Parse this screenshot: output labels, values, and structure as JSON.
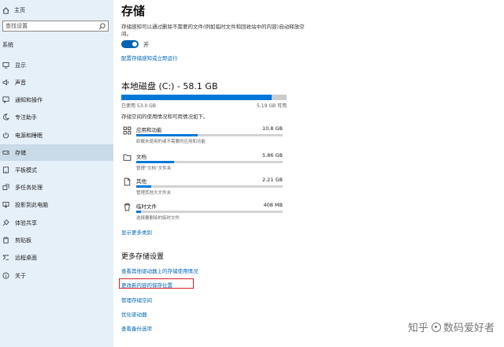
{
  "sidebar": {
    "home_label": "主页",
    "search_placeholder": "查找设置",
    "section_label": "系统",
    "items": [
      {
        "label": "显示",
        "icon": "monitor-icon"
      },
      {
        "label": "声音",
        "icon": "speaker-icon"
      },
      {
        "label": "通知和操作",
        "icon": "notification-icon"
      },
      {
        "label": "专注助手",
        "icon": "moon-icon"
      },
      {
        "label": "电源和睡眠",
        "icon": "power-icon"
      },
      {
        "label": "存储",
        "icon": "storage-icon",
        "active": true
      },
      {
        "label": "平板模式",
        "icon": "tablet-icon"
      },
      {
        "label": "多任务处理",
        "icon": "multitask-icon"
      },
      {
        "label": "投影到此电脑",
        "icon": "projector-icon"
      },
      {
        "label": "体验共享",
        "icon": "share-icon"
      },
      {
        "label": "剪贴板",
        "icon": "clipboard-icon"
      },
      {
        "label": "远程桌面",
        "icon": "remote-icon"
      },
      {
        "label": "关于",
        "icon": "info-icon"
      }
    ]
  },
  "main": {
    "title": "存储",
    "description": "存储感知可以通过删除不需要的文件(例如临时文件和回收站中的内容)自动释放空间。",
    "toggle_label": "开",
    "toggle_on": true,
    "configure_link": "配置存储感知或立即运行",
    "disk_title": "本地磁盘 (C:) - 58.1 GB",
    "disk_used_text": "已使用 53.0 GB",
    "disk_free_text": "5.19 GB 可用",
    "disk_used_fraction": 0.91,
    "categories_desc": "存储空间的使用情况和可用情况如下。",
    "categories": [
      {
        "name": "应用和功能",
        "size": "10.8 GB",
        "sub": "卸载未使用的或不需要的应用和功能",
        "fraction": 0.42,
        "icon": "apps-icon"
      },
      {
        "name": "文档",
        "size": "5.86 GB",
        "sub": "管理“文档”文件夹",
        "fraction": 0.26,
        "icon": "document-icon"
      },
      {
        "name": "其他",
        "size": "2.21 GB",
        "sub": "管理其他大文件夹",
        "fraction": 0.1,
        "icon": "other-icon"
      },
      {
        "name": "临时文件",
        "size": "408 MB",
        "sub": "选择要删除的临时文件",
        "fraction": 0.03,
        "icon": "trash-icon"
      }
    ],
    "show_more_link": "显示更多类别",
    "more_settings_title": "更多存储设置",
    "more_links": [
      "查看其他驱动器上的存储使用情况",
      "更改新内容的保存位置",
      "管理存储空间",
      "优化驱动器",
      "查看备份选项"
    ],
    "highlight_color": "#d32028",
    "accent_color": "#0078d7"
  },
  "watermark": {
    "left": "知乎",
    "right": "数码爱好者"
  }
}
